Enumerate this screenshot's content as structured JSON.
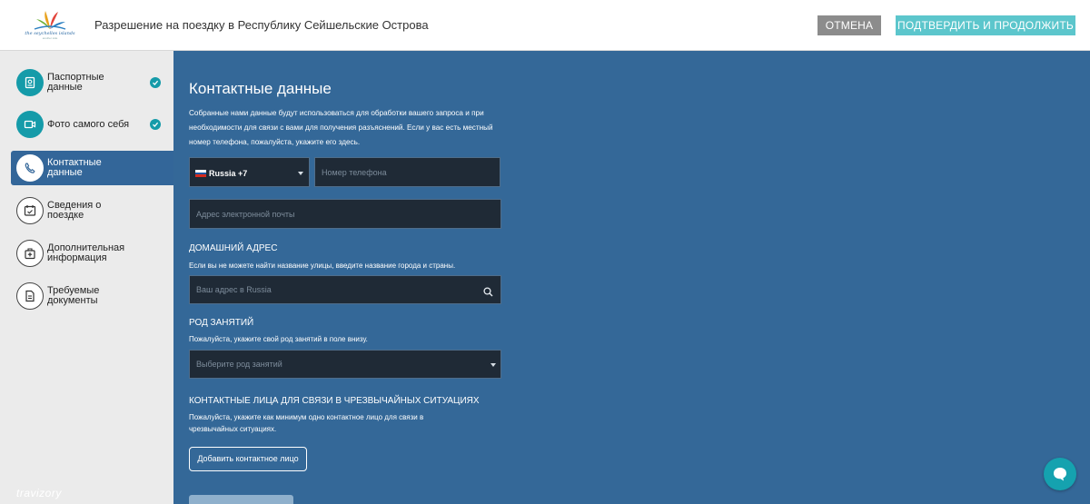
{
  "header": {
    "logo_text": "the seychelles islands",
    "logo_sub": "another side",
    "title": "Разрешение на поездку в Республику Сейшельские Острова",
    "cancel_label": "ОТМЕНА",
    "confirm_label": "ПОДТВЕРДИТЬ И ПРОДОЛЖИТЬ"
  },
  "sidebar": {
    "items": [
      {
        "label": "Паспортные данные",
        "icon": "passport-icon",
        "completed": true
      },
      {
        "label": "Фото самого себя",
        "icon": "camera-icon",
        "completed": true
      },
      {
        "label": "Контактные данные",
        "icon": "phone-icon",
        "active": true
      },
      {
        "label": "Сведения о поездке",
        "icon": "calendar-icon"
      },
      {
        "label": "Дополнительная информация",
        "icon": "medical-kit-icon"
      },
      {
        "label": "Требуемые документы",
        "icon": "document-icon"
      }
    ],
    "brand": "travizory"
  },
  "main": {
    "title": "Контактные данные",
    "intro": "Собранные нами данные будут использоваться для обработки вашего запроса и при необходимости для связи с вами для получения разъяснений. Если у вас есть местный номер телефона, пожалуйста, укажите его здесь.",
    "country_value": "Russia +7",
    "phone_placeholder": "Номер телефона",
    "email_placeholder": "Адрес электронной почты",
    "home_address": {
      "title": "ДОМАШНИЙ АДРЕС",
      "hint": "Если вы не можете найти название улицы, введите название города и страны.",
      "placeholder": "Ваш адрес в Russia"
    },
    "occupation": {
      "title": "РОД ЗАНЯТИЙ",
      "hint": "Пожалуйста, укажите свой род занятий в поле внизу.",
      "placeholder": "Выберите род занятий"
    },
    "emergency": {
      "title": "КОНТАКТНЫЕ ЛИЦА ДЛЯ СВЯЗИ В ЧРЕЗВЫЧАЙНЫХ СИТУАЦИЯХ",
      "hint": "Пожалуйста, укажите как минимум одно контактное лицо для связи в чрезвычайных ситуациях.",
      "add_label": "Добавить контактное лицо"
    }
  },
  "colors": {
    "accent": "#159ba9",
    "main_bg": "#346898",
    "field_bg": "#1f2a36",
    "confirm": "#5cc6cc",
    "cancel": "#8c8c8c"
  }
}
